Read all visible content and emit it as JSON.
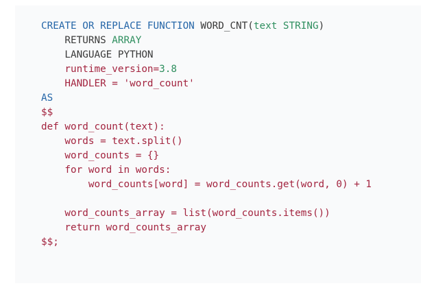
{
  "code_lines": [
    [
      {
        "t": "CREATE OR REPLACE FUNCTION",
        "c": "blue"
      },
      {
        "t": " WORD_CNT(",
        "c": "black"
      },
      {
        "t": "text",
        "c": "green"
      },
      {
        "t": " ",
        "c": "black"
      },
      {
        "t": "STRING",
        "c": "green"
      },
      {
        "t": ")",
        "c": "black"
      }
    ],
    [
      {
        "t": "    RETURNS ",
        "c": "black"
      },
      {
        "t": "ARRAY",
        "c": "green"
      }
    ],
    [
      {
        "t": "    LANGUAGE PYTHON",
        "c": "black"
      }
    ],
    [
      {
        "t": "    runtime_version=",
        "c": "red"
      },
      {
        "t": "3.8",
        "c": "green"
      }
    ],
    [
      {
        "t": "    HANDLER = 'word_count'",
        "c": "red"
      }
    ],
    [
      {
        "t": "AS",
        "c": "blue"
      }
    ],
    [
      {
        "t": "$$",
        "c": "red"
      }
    ],
    [
      {
        "t": "def word_count(text):",
        "c": "red"
      }
    ],
    [
      {
        "t": "    words = text.split()",
        "c": "red"
      }
    ],
    [
      {
        "t": "    word_counts = {}",
        "c": "red"
      }
    ],
    [
      {
        "t": "    for word in words:",
        "c": "red"
      }
    ],
    [
      {
        "t": "        word_counts[word] = word_counts.get(word, 0) + 1",
        "c": "red"
      }
    ],
    [],
    [
      {
        "t": "    word_counts_array = list(word_counts.items())",
        "c": "red"
      }
    ],
    [
      {
        "t": "    return word_counts_array",
        "c": "red"
      }
    ],
    [
      {
        "t": "$$;",
        "c": "red"
      }
    ]
  ],
  "colors": {
    "blue": "#2566a8",
    "green": "#2f8f5f",
    "black": "#3a3a3a",
    "red": "#a3243f",
    "panel_background": "#f9fafb"
  }
}
